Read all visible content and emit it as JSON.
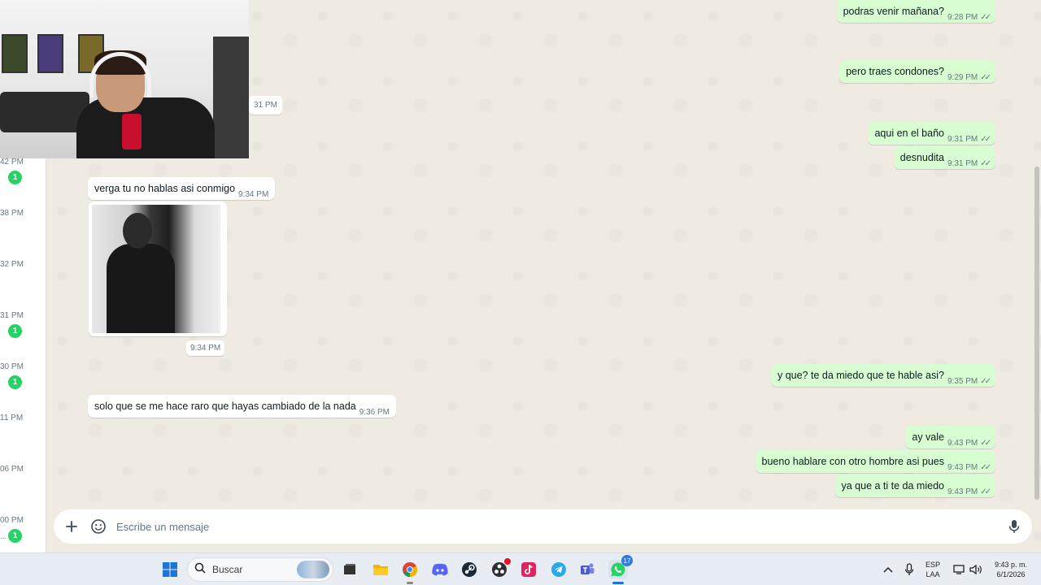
{
  "chat_list": {
    "entries": [
      {
        "time": "42 PM",
        "badge": "1"
      },
      {
        "time": "38 PM",
        "badge": ""
      },
      {
        "time": "32 PM",
        "badge": ""
      },
      {
        "time": "31 PM",
        "badge": "1"
      },
      {
        "time": "30 PM",
        "badge": "1"
      },
      {
        "time": "11 PM",
        "badge": ""
      },
      {
        "time": "06 PM",
        "badge": ""
      },
      {
        "time": "00 PM",
        "badge": "1"
      }
    ],
    "last_dots": "..."
  },
  "conversation": {
    "stray_time": "31 PM",
    "outgoing_top": [
      {
        "text": "podras venir mañana?",
        "time": "9:28 PM",
        "ticks": "✓✓"
      },
      {
        "text": "pero traes condones?",
        "time": "9:29 PM",
        "ticks": "✓✓"
      },
      {
        "text": "aqui en el baño",
        "time": "9:31 PM",
        "ticks": "✓✓"
      },
      {
        "text": "desnudita",
        "time": "9:31 PM",
        "ticks": "✓✓"
      }
    ],
    "incoming": [
      {
        "text": "verga tu no hablas asi conmigo",
        "time": "9:34 PM"
      },
      {
        "text": "solo que se me hace raro que hayas cambiado de la nada",
        "time": "9:36 PM"
      }
    ],
    "photo_time": "9:34 PM",
    "outgoing_bottom": [
      {
        "text": "y que? te da miedo que te hable asi?",
        "time": "9:35 PM",
        "ticks": "✓✓"
      },
      {
        "text": "ay vale",
        "time": "9:43 PM",
        "ticks": "✓✓"
      },
      {
        "text": "bueno hablare con otro hombre asi pues",
        "time": "9:43 PM",
        "ticks": "✓✓"
      },
      {
        "text": "ya que a ti te da miedo",
        "time": "9:43 PM",
        "ticks": "✓✓"
      }
    ]
  },
  "composer": {
    "placeholder": "Escribe un mensaje"
  },
  "taskbar": {
    "search_label": "Buscar",
    "whatsapp_badge": "17",
    "lang_line1": "ESP",
    "lang_line2": "LAA",
    "clock_time": "9:43 p. m.",
    "clock_date": "6/1/2026"
  },
  "colors": {
    "outgoing_bubble": "#d9fdd3",
    "incoming_bubble": "#ffffff",
    "chat_background": "#efeae2",
    "unread_badge": "#25d366"
  }
}
